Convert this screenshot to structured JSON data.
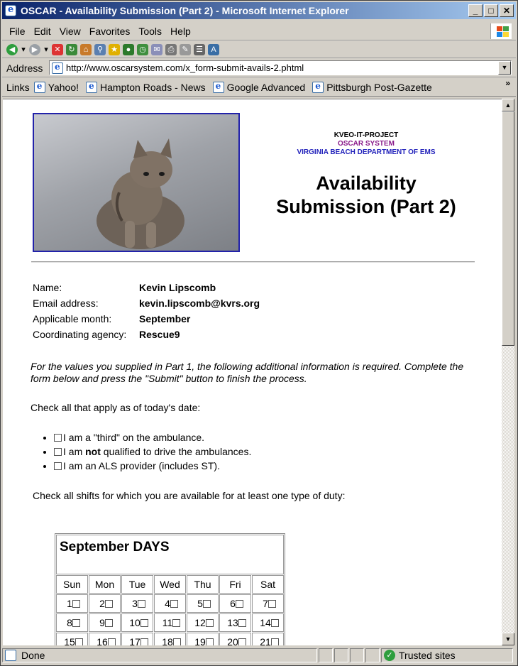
{
  "window": {
    "title": "OSCAR - Availability Submission (Part 2) - Microsoft Internet Explorer"
  },
  "menu": [
    "File",
    "Edit",
    "View",
    "Favorites",
    "Tools",
    "Help"
  ],
  "address": {
    "label": "Address",
    "url": "http://www.oscarsystem.com/x_form-submit-avails-2.phtml"
  },
  "links": {
    "label": "Links",
    "items": [
      "Yahoo!",
      "Hampton Roads - News",
      "Google Advanced",
      "Pittsburgh Post-Gazette"
    ]
  },
  "header": {
    "org_line1": "KVEO-IT-PROJECT",
    "org_line2": "OSCAR SYSTEM",
    "org_line3": "VIRGINIA BEACH DEPARTMENT OF EMS",
    "title_line1": "Availability",
    "title_line2": "Submission (Part 2)"
  },
  "info": [
    {
      "label": "Name:",
      "value": "Kevin Lipscomb"
    },
    {
      "label": "Email address:",
      "value": "kevin.lipscomb@kvrs.org"
    },
    {
      "label": "Applicable month:",
      "value": "September"
    },
    {
      "label": "Coordinating agency:",
      "value": "Rescue9"
    }
  ],
  "intro": "For the values you supplied in Part 1, the following additional information is required.  Complete the form below and press the \"Submit\" button to finish the process.",
  "check_prompt": "Check all that apply as of today's date:",
  "options": {
    "third": "I am a \"third\" on the ambulance.",
    "not_qualified_pre": "I am ",
    "not_qualified_bold": "not",
    "not_qualified_post": " qualified to drive the ambulances.",
    "als": "I am an ALS provider (includes ST)."
  },
  "shifts_prompt": "Check all shifts for which you are available for at least one type of duty:",
  "calendar": {
    "heading": "September DAYS",
    "days": [
      "Sun",
      "Mon",
      "Tue",
      "Wed",
      "Thu",
      "Fri",
      "Sat"
    ],
    "week1": [
      "1",
      "2",
      "3",
      "4",
      "5",
      "6",
      "7"
    ],
    "week2": [
      "8",
      "9",
      "10",
      "11",
      "12",
      "13",
      "14"
    ],
    "week3": [
      "15",
      "16",
      "17",
      "18",
      "19",
      "20",
      "21"
    ]
  },
  "status": {
    "left": "Done",
    "zone": "Trusted sites"
  }
}
